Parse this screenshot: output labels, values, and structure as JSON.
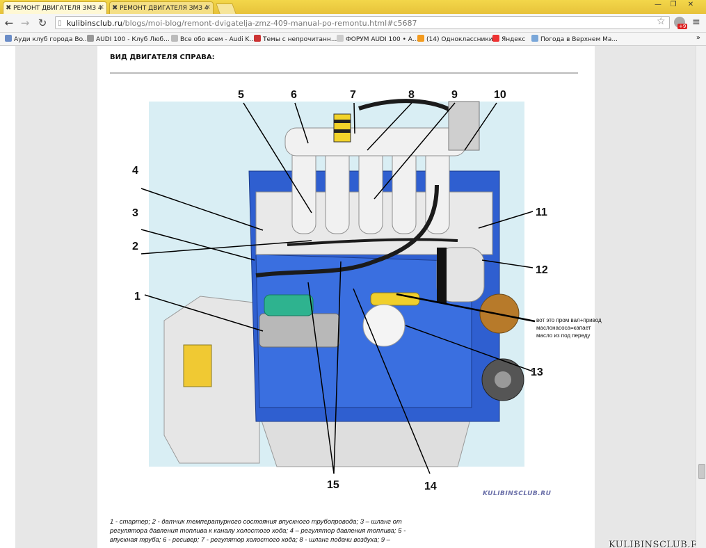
{
  "browser": {
    "tabs": [
      {
        "title": "РЕМОНТ ДВИГАТЕЛЯ ЗМЗ 4",
        "active": true
      },
      {
        "title": "РЕМОНТ ДВИГАТЕЛЯ ЗМЗ 4",
        "active": false
      }
    ],
    "url_host": "kulibinsclub.ru",
    "url_path": "/blogs/moi-blog/remont-dvigatelja-zmz-409-manual-po-remontu.html#c5687",
    "extension_badge": "+9",
    "bookmarks": [
      "Ауди клуб города Во...",
      "AUDI 100 - Клуб Люб...",
      "Все обо всем - Audi K...",
      "Темы с непрочитанн...",
      "ФОРУМ AUDI 100 • А...",
      "(14) Одноклассники",
      "Яндекс",
      "Погода в Верхнем Ма..."
    ],
    "bookmarks_more": "»"
  },
  "article": {
    "section_title": "ВИД ДВИГАТЕЛЯ СПРАВА:",
    "callouts": [
      "1",
      "2",
      "3",
      "4",
      "5",
      "6",
      "7",
      "8",
      "9",
      "10",
      "11",
      "12",
      "13",
      "14",
      "15"
    ],
    "figure_watermark": "KULIBINSCLUB.RU",
    "note_lines": [
      "вот это пром вал+привод",
      "маслонасоса=капает",
      "масло из под переду"
    ],
    "caption_lines": [
      "1 - стартер; 2 - датчик температурного состояния впускного трубопровода; 3 – шланг от",
      "регулятора давления топлива к каналу холостого хода; 4 – регулятор давления топлива; 5 -",
      "впускная труба; 6 - ресивер; 7 - регулятор холостого хода; 8 - шланг подачи воздуха; 9 –"
    ]
  },
  "site_watermark": "KULIBINSCLUB.RU",
  "colors": {
    "tab_strip": "#e7c23a",
    "engine_block": "#2f5fd0",
    "figure_bg": "#d9eef4"
  }
}
